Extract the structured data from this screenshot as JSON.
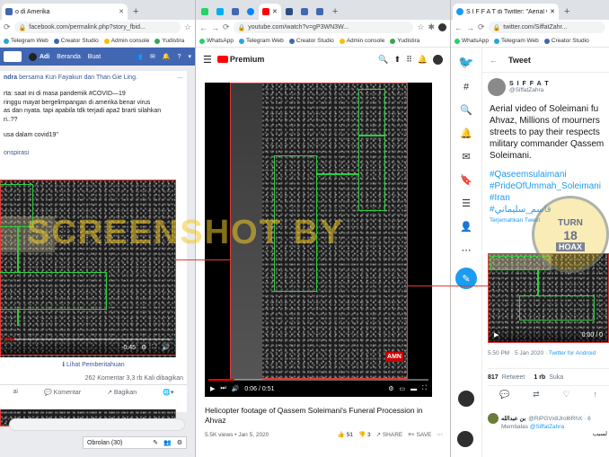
{
  "watermark": "SCREENSHOT BY",
  "left": {
    "tab_title": "o di Amerika",
    "url": "facebook.com/permalink.php?story_fbid...",
    "bookmarks": [
      "Telegram Web",
      "Creator Studio",
      "Admin console",
      "Yudistira"
    ],
    "nav": {
      "user": "Adi",
      "home": "Beranda",
      "create": "Buat"
    },
    "post_author": "ndra",
    "post_with": "bersama Kun Fayakun dan Than Gie Ling.",
    "post_lines": [
      "rta: saat ini di masa pandemik #COVID—19",
      "ringgu mayat bergelimpangan di amerika benar virus",
      "as dan nyata. tapi apabila tdk terjadi apa2 brarti silahkan",
      "ri..??",
      "",
      "usa dalam covid19\""
    ],
    "hashtag": "onspirasi",
    "video_time": "-0:45",
    "see_translation": "Lihat Pemberitahuan",
    "stats": "262 Komentar  3,3 rb Kali dibagikan",
    "actions": {
      "like": "ai",
      "comment": "Komentar",
      "share": "Bagikan"
    },
    "chat": "Obrolan (30)"
  },
  "middle": {
    "url": "youtube.com/watch?v=gP3WN3W...",
    "bookmarks": [
      "WhatsApp",
      "Telegram Web",
      "Creator Studio",
      "Admin console",
      "Yudistira"
    ],
    "logo": "Premium",
    "time": "0:06 / 0:51",
    "title": "Helicopter footage of Qassem Soleimani's Funeral Procession in Ahvaz",
    "meta": "5.5K views • Jan 5, 2020",
    "likes": "51",
    "dislikes": "3",
    "share": "SHARE",
    "save": "SAVE",
    "channel_badge": "AMN",
    "progress": 0.12
  },
  "right": {
    "tab_title": "S I F F A T di Twitter: \"Aerial vide",
    "url": "twitter.com/SiffatZahr...",
    "bookmarks": [
      "WhatsApp",
      "Telegram Web",
      "Creator Studio"
    ],
    "header": "Tweet",
    "name": "S I F F A T",
    "handle": "@SiffatZahra",
    "text_lines": [
      "Aerial video of Soleimani fu",
      "Ahvaz, Millions of mourners",
      "streets to pay their respects",
      "military commander Qassem",
      "Soleimani."
    ],
    "hashtags": [
      "#Qaseemsulaimani",
      "#PrideOfUmmah_Soleimani",
      "#Iran",
      "#قاسم_سليماني"
    ],
    "translate": "Terjemahkan Tweet",
    "video_time": "0:00 / 0",
    "timestamp": "5.50 PM · 5 Jan 2020 · ",
    "source": "Twitter for Android",
    "retweets": "817",
    "retweets_label": "Retweet",
    "likes": "1 rb",
    "likes_label": "Suka",
    "reply_count": "1",
    "rt_count": "18",
    "reply_name": "بن عبدالله",
    "reply_handle": "@RiPGVx8Jrol6RhX · 6",
    "reply_to": "Membalas @SiffatZahra",
    "reply_suffix": "لسيب",
    "stamp_top": "TURN",
    "stamp_mid": "18",
    "stamp_bot": "HOAX"
  },
  "colors": {
    "fb_blue": "#4267b2",
    "yt_red": "#ff0000",
    "tw_blue": "#1d9bf0",
    "box_green": "#2ecc40",
    "line_red": "#e53935"
  }
}
